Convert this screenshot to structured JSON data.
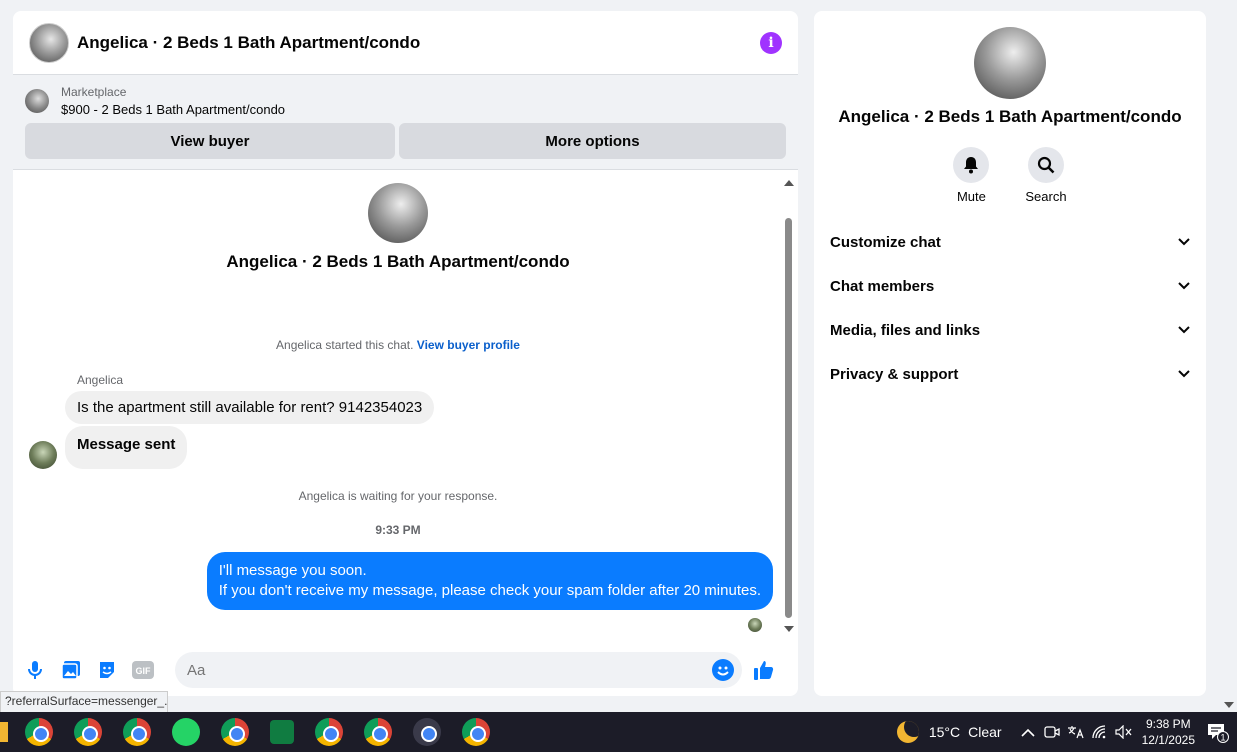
{
  "chat": {
    "title": "Angelica · 2 Beds 1 Bath Apartment/condo",
    "info_icon": "i",
    "marketplace_label": "Marketplace",
    "listing": "$900 - 2 Beds 1 Bath Apartment/condo",
    "view_buyer": "View buyer",
    "more_options": "More options"
  },
  "thread": {
    "title": "Angelica · 2 Beds 1 Bath Apartment/condo",
    "started_text": "Angelica started this chat.",
    "view_profile": "View buyer profile",
    "sender": "Angelica",
    "msg1": "Is the apartment still available for rent? 9142354023",
    "msg2": "Message sent",
    "waiting": "Angelica is waiting for your response.",
    "time": "9:33 PM",
    "out_line1": "I'll message you soon.",
    "out_line2": "If you don't receive my message, please check your spam folder after 20 minutes."
  },
  "composer": {
    "placeholder": "Aa",
    "gif": "GIF"
  },
  "url_tip": "?referralSurface=messenger_...",
  "info": {
    "title": "Angelica · 2 Beds 1 Bath Apartment/condo",
    "mute": "Mute",
    "search": "Search",
    "sections": [
      "Customize chat",
      "Chat members",
      "Media, files and links",
      "Privacy & support"
    ]
  },
  "taskbar": {
    "temp": "15°C",
    "condition": "Clear",
    "time": "9:38 PM",
    "date": "12/1/2025",
    "notifications": "1"
  },
  "colors": {
    "accent": "#0a7cff",
    "info": "#a033ff",
    "link": "#0a5fcb"
  }
}
